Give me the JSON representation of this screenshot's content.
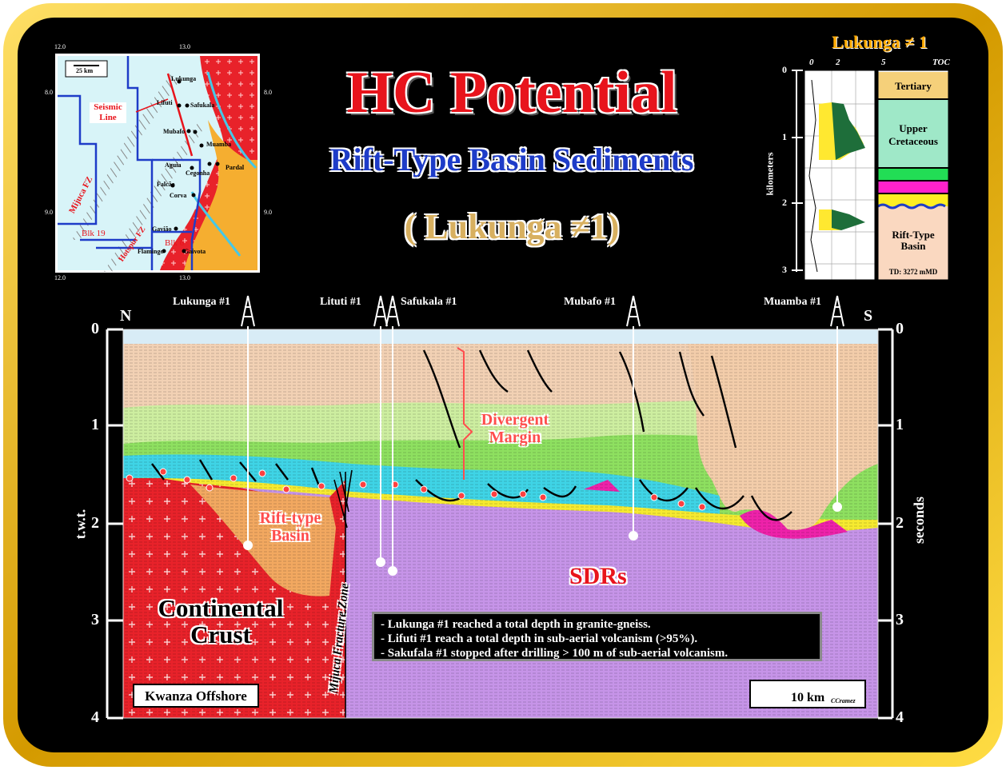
{
  "title": "HC Potential",
  "subtitle": "Rift-Type Basin Sediments",
  "subtitle_well": "( Lukunga  ≠1)",
  "inset_map": {
    "scale": "25 km",
    "lon_ticks": [
      "12.0",
      "13.0"
    ],
    "lat_ticks": [
      "8.0",
      "9.0"
    ],
    "seismic_line_label": "Seismic Line",
    "fault_zones": [
      "Mijuca FZ",
      "Hotspur FZ"
    ],
    "blocks": [
      "Blk 19",
      "Blk 6"
    ],
    "wells": [
      "Lukunga",
      "Lifuti",
      "Safukala",
      "Mubafo",
      "Muamba",
      "Aguia",
      "Pardal",
      "Cegonha",
      "Falcão",
      "Corva",
      "Gavião",
      "Flamingo",
      "Gaivota"
    ]
  },
  "well_log": {
    "title": "Lukunga ≠ 1",
    "toc_label": "TOC",
    "toc_ticks": [
      "0",
      "2",
      "5"
    ],
    "depth_label": "kilometers",
    "depth_ticks": [
      "0",
      "1",
      "2",
      "3"
    ],
    "units": [
      {
        "name": "Tertiary",
        "color": "#f5d07a"
      },
      {
        "name": "Upper Cretaceous",
        "color": "#9fe8c8"
      },
      {
        "name": "",
        "color": "#22dd55"
      },
      {
        "name": "",
        "color": "#ff22cc"
      },
      {
        "name": "",
        "color": "#ffee22"
      },
      {
        "name": "Rift-Type Basin",
        "color": "#fad8c0"
      }
    ],
    "td": "TD: 3272 mMD"
  },
  "section": {
    "north": "N",
    "south": "S",
    "wells": [
      "Lukunga #1",
      "Lituti #1",
      "Safukala #1",
      "Mubafo #1",
      "Muamba #1"
    ],
    "y_ticks": [
      "0",
      "1",
      "2",
      "3",
      "4"
    ],
    "left_axis_label": "t.w.t.",
    "right_axis_label": "seconds",
    "labels": {
      "divergent": "Divergent Margin",
      "rift": "Rift-type Basin",
      "sdrs": "SDRs",
      "crust": "Continental Crust",
      "fracture": "Mijuca Fracture Zone"
    },
    "notes": [
      "- Lukunga #1 reached a total depth in granite-gneiss.",
      "- Lifuti #1 reach a total depth in sub-aerial volcanism (>95%).",
      "- Sakufala #1 stopped after drilling > 100 m of sub-aerial volcanism."
    ],
    "location": "Kwanza Offshore",
    "scale": "10 km",
    "credit": "CCramez"
  }
}
